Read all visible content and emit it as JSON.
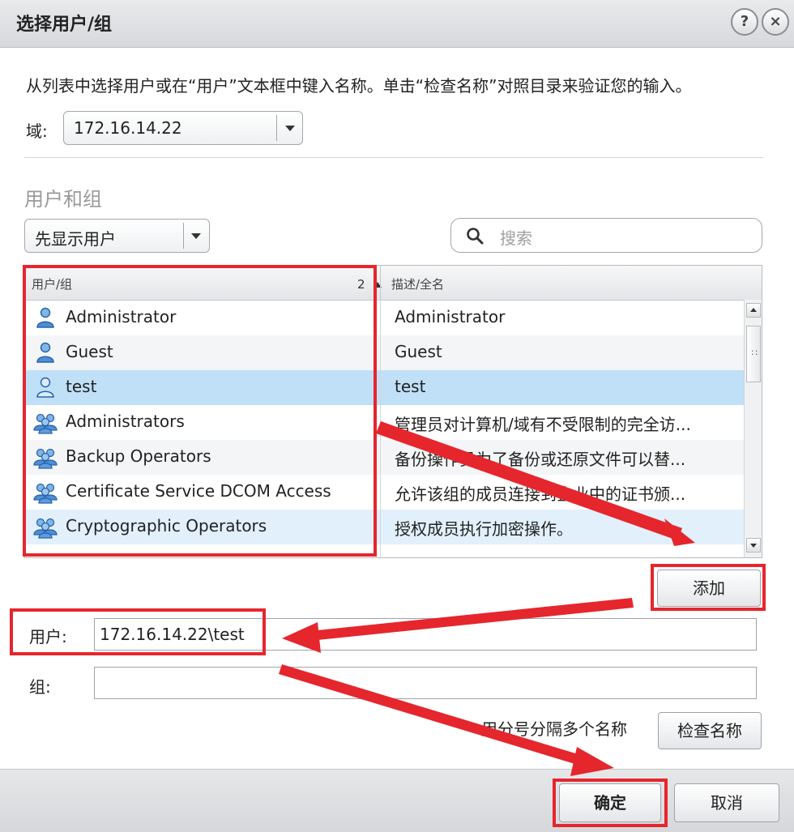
{
  "dialog": {
    "title": "选择用户/组",
    "help_label": "?",
    "close_label": "×",
    "instruction": "从列表中选择用户或在“用户”文本框中键入名称。单击“检查名称”对照目录来验证您的输入。"
  },
  "domain": {
    "label": "域:",
    "value": "172.16.14.22"
  },
  "users_groups": {
    "section_title": "用户和组",
    "filter_value": "先显示用户",
    "search_placeholder": "搜索",
    "columns": {
      "name": "用户/组",
      "description": "描述/全名",
      "sort_index": "2"
    },
    "rows": [
      {
        "name": "Administrator",
        "description": "Administrator",
        "type": "user",
        "selected": false
      },
      {
        "name": "Guest",
        "description": "Guest",
        "type": "user",
        "selected": false
      },
      {
        "name": "test",
        "description": "test",
        "type": "user",
        "selected": true
      },
      {
        "name": "Administrators",
        "description": "管理员对计算机/域有不受限制的完全访...",
        "type": "group",
        "selected": false
      },
      {
        "name": "Backup Operators",
        "description": "备份操作员为了备份或还原文件可以替...",
        "type": "group",
        "selected": false
      },
      {
        "name": "Certificate Service DCOM Access",
        "description": "允许该组的成员连接到企业中的证书颁...",
        "type": "group",
        "selected": false
      },
      {
        "name": "Cryptographic Operators",
        "description": "授权成员执行加密操作。",
        "type": "group",
        "selected": false
      }
    ]
  },
  "actions": {
    "add_label": "添加",
    "check_names_label": "检查名称",
    "ok_label": "确定",
    "cancel_label": "取消"
  },
  "entry": {
    "user_label": "用户:",
    "user_value": "172.16.14.22\\test",
    "group_label": "组:",
    "group_value": "",
    "separator_hint": "用分号分隔多个名称"
  },
  "colors": {
    "annotation_red": "#e5262d",
    "selection_blue": "#bfe0f7"
  }
}
